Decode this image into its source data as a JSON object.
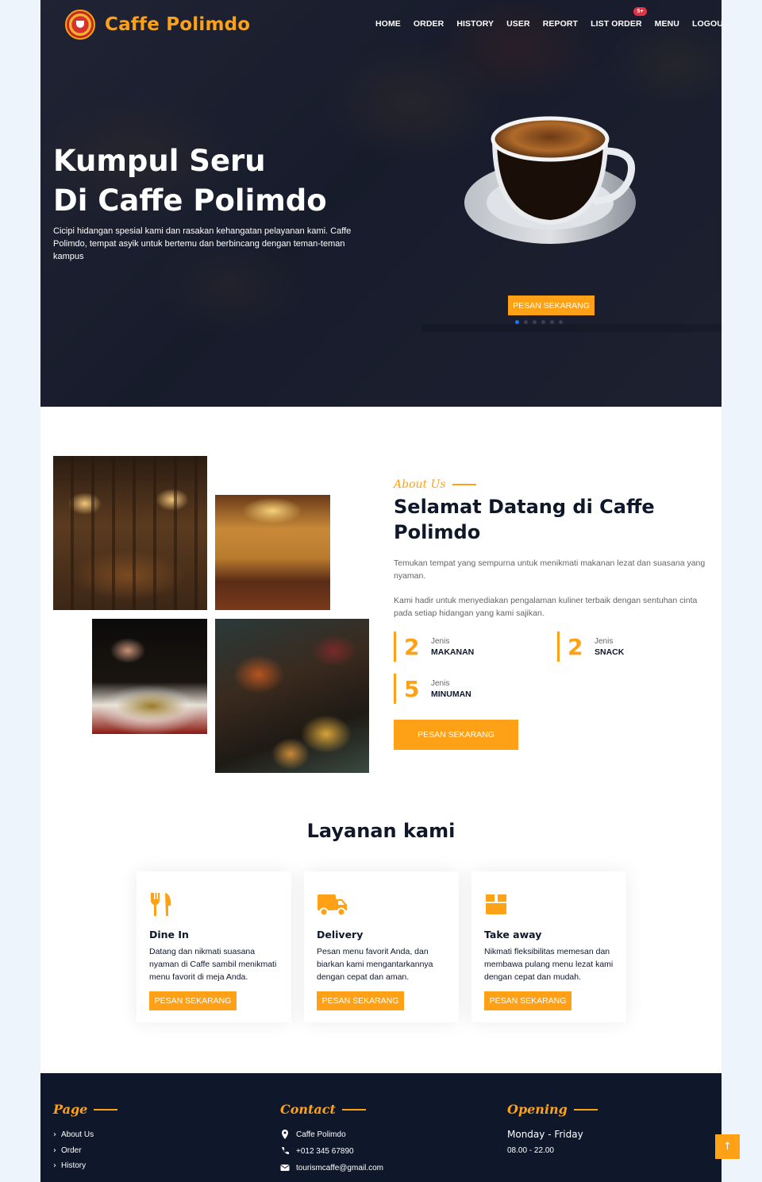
{
  "brand": {
    "name": "Caffe Polimdo"
  },
  "nav": [
    {
      "label": "HOME"
    },
    {
      "label": "ORDER"
    },
    {
      "label": "HISTORY"
    },
    {
      "label": "USER"
    },
    {
      "label": "REPORT"
    },
    {
      "label": "LIST ORDER",
      "badge": "5+"
    },
    {
      "label": "MENU"
    },
    {
      "label": "LOGOUT"
    }
  ],
  "hero": {
    "title_line1": "Kumpul Seru",
    "title_line2": "Di Caffe Polimdo",
    "description": "Cicipi hidangan spesial kami dan rasakan kehangatan pelayanan kami. Caffe Polimdo, tempat asyik untuk bertemu dan berbincang dengan teman-teman kampus",
    "cta": "PESAN SEKARANG",
    "slide_count": 6,
    "active_slide": 1
  },
  "about": {
    "subtitle": "About Us",
    "title": "Selamat Datang di Caffe Polimdo",
    "p1": "Temukan tempat yang sempurna untuk menikmati makanan lezat dan suasana yang nyaman.",
    "p2": "Kami hadir untuk menyediakan pengalaman kuliner terbaik dengan sentuhan cinta pada setiap hidangan yang kami sajikan.",
    "stats": [
      {
        "number": "2",
        "small": "Jenis",
        "big": "MAKANAN"
      },
      {
        "number": "2",
        "small": "Jenis",
        "big": "SNACK"
      },
      {
        "number": "5",
        "small": "Jenis",
        "big": "MINUMAN"
      }
    ],
    "cta": "PESAN SEKARANG"
  },
  "services": {
    "title": "Layanan kami",
    "items": [
      {
        "icon": "utensils-icon",
        "title": "Dine In",
        "text": "Datang dan nikmati suasana nyaman di Caffe sambil menikmati menu favorit di meja Anda.",
        "cta": "PESAN SEKARANG"
      },
      {
        "icon": "truck-icon",
        "title": "Delivery",
        "text": "Pesan menu favorit Anda, dan biarkan kami mengantarkannya dengan cepat dan aman.",
        "cta": "PESAN SEKARANG"
      },
      {
        "icon": "box-icon",
        "title": "Take away",
        "text": "Nikmati fleksibilitas memesan dan membawa pulang menu lezat kami dengan cepat dan mudah.",
        "cta": "PESAN SEKARANG"
      }
    ]
  },
  "footer": {
    "page_title": "Page",
    "links": [
      "About Us",
      "Order",
      "History"
    ],
    "contact_title": "Contact",
    "contact": {
      "location": "Caffe Polimdo",
      "phone": "+012 345 67890",
      "email": "tourismcaffe@gmail.com"
    },
    "opening_title": "Opening",
    "opening_days": "Monday - Friday",
    "opening_hours": "08.00 - 22.00"
  },
  "colors": {
    "accent": "#fea116",
    "dark": "#0f172b",
    "badge": "#dc3545"
  }
}
